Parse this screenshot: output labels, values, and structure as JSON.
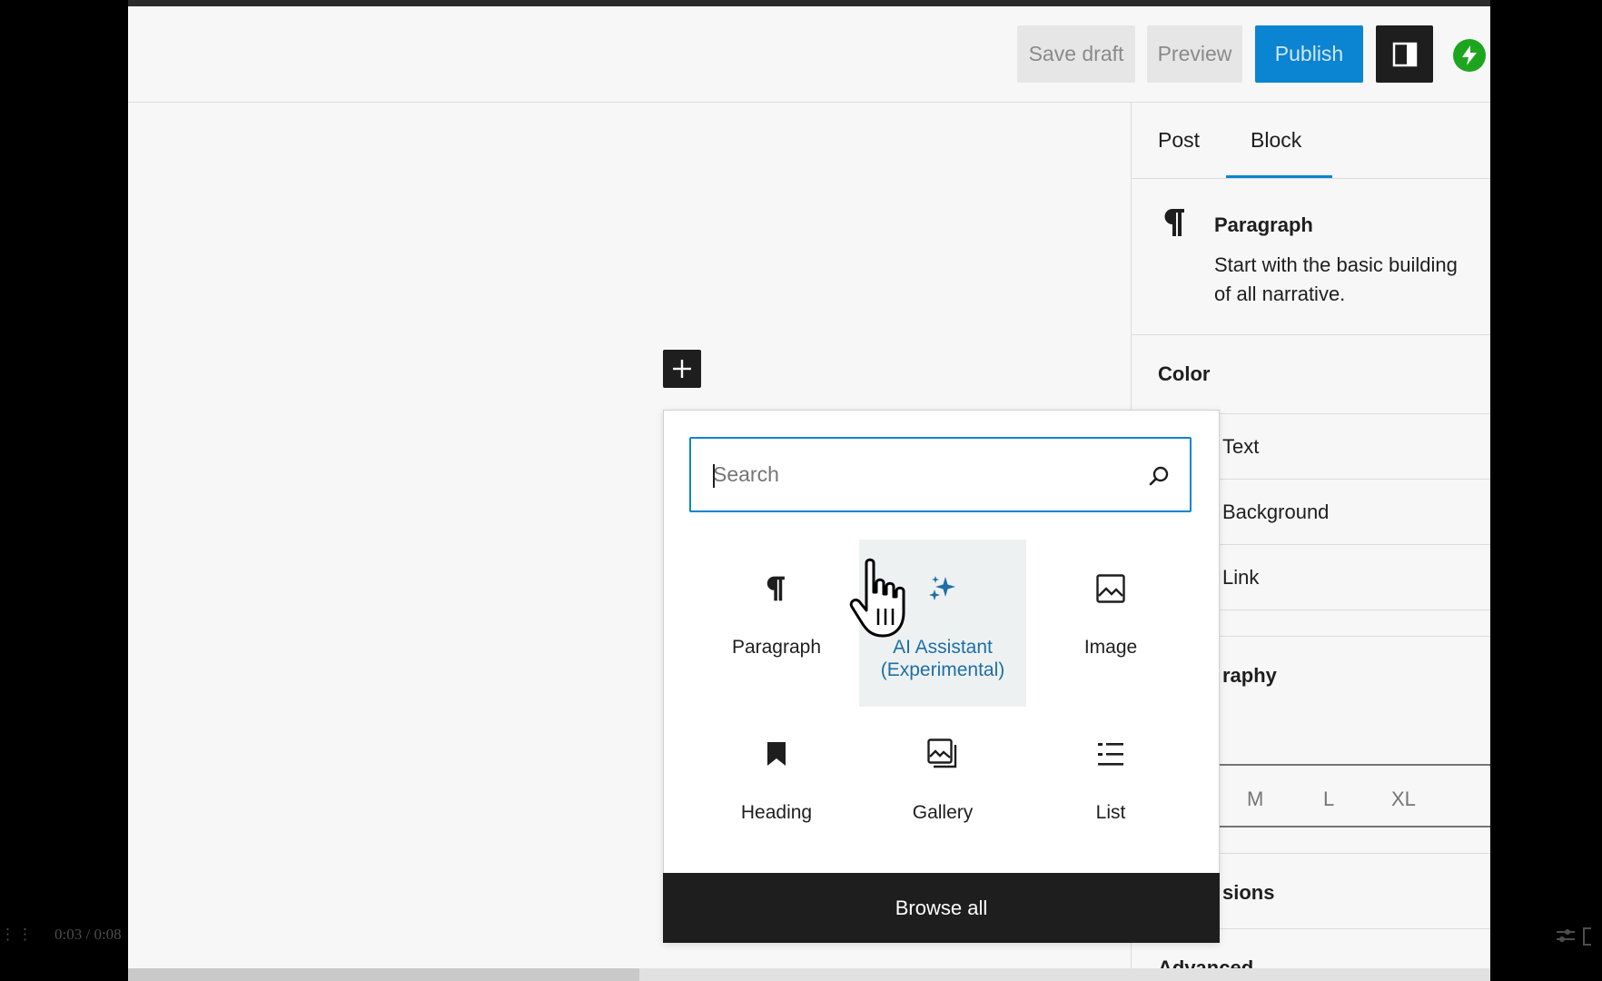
{
  "toolbar": {
    "save_draft": "Save draft",
    "preview": "Preview",
    "publish": "Publish",
    "settings_icon": "sidebar-toggle-icon",
    "jetpack_icon": "jetpack-bolt-icon"
  },
  "sidebar": {
    "tabs": [
      {
        "label": "Post"
      },
      {
        "label": "Block"
      }
    ],
    "active_tab": "Block",
    "block_card": {
      "icon": "pilcrow-icon",
      "title": "Paragraph",
      "description_line1": "Start with the basic building",
      "description_line2": "of all narrative."
    },
    "color_heading": "Color",
    "color_items": [
      "Text",
      "Background",
      "Link"
    ],
    "typography_heading": "raphy",
    "size_options": [
      "M",
      "L",
      "XL"
    ],
    "dimensions_heading": "sions",
    "advanced_heading": "Advanced"
  },
  "inserter": {
    "search_placeholder": "Search",
    "blocks": [
      {
        "label": "Paragraph",
        "icon": "pilcrow-icon"
      },
      {
        "label": "AI Assistant (Experimental)",
        "label1": "AI Assistant",
        "label2": "(Experimental)",
        "icon": "sparkles-icon"
      },
      {
        "label": "Image",
        "icon": "image-icon"
      },
      {
        "label": "Heading",
        "icon": "bookmark-icon"
      },
      {
        "label": "Gallery",
        "icon": "gallery-icon"
      },
      {
        "label": "List",
        "icon": "list-icon"
      }
    ],
    "browse_all": "Browse all"
  },
  "player": {
    "time": "0:03 / 0:08",
    "progress": 0.375
  },
  "colors": {
    "accent": "#0b84d1",
    "dark": "#1e1e1e",
    "jetpack": "#1ea51e",
    "ai_label": "#1d6fa5"
  }
}
